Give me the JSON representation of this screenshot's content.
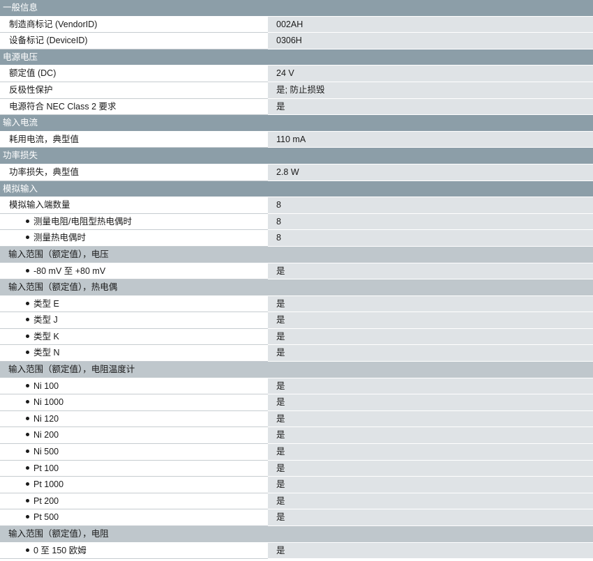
{
  "rows": [
    {
      "type": "section",
      "text": "一般信息"
    },
    {
      "type": "data",
      "level": 0,
      "label": "制造商标记 (VendorID)",
      "value": "002AH"
    },
    {
      "type": "data",
      "level": 0,
      "label": "设备标记 (DeviceID)",
      "value": "0306H"
    },
    {
      "type": "section",
      "text": "电源电压"
    },
    {
      "type": "data",
      "level": 0,
      "label": "额定值 (DC)",
      "value": "24 V"
    },
    {
      "type": "data",
      "level": 0,
      "label": "反极性保护",
      "value": "是; 防止损毁"
    },
    {
      "type": "data",
      "level": 0,
      "label": "电源符合 NEC Class 2 要求",
      "value": "是"
    },
    {
      "type": "section",
      "text": "输入电流"
    },
    {
      "type": "data",
      "level": 0,
      "label": "耗用电流，典型值",
      "value": "110 mA"
    },
    {
      "type": "section",
      "text": "功率损失"
    },
    {
      "type": "data",
      "level": 0,
      "label": "功率损失，典型值",
      "value": "2.8 W"
    },
    {
      "type": "section",
      "text": "模拟输入"
    },
    {
      "type": "data",
      "level": 0,
      "label": "模拟输入端数量",
      "value": "8"
    },
    {
      "type": "data",
      "level": 1,
      "label": "测量电阻/电阻型热电偶时",
      "value": "8"
    },
    {
      "type": "data",
      "level": 1,
      "label": "测量热电偶时",
      "value": "8"
    },
    {
      "type": "subsection",
      "text": "输入范围（额定值），电压"
    },
    {
      "type": "data",
      "level": 1,
      "label": "-80 mV 至 +80 mV",
      "value": "是"
    },
    {
      "type": "subsection",
      "text": "输入范围（额定值），热电偶"
    },
    {
      "type": "data",
      "level": 1,
      "label": "类型 E",
      "value": "是"
    },
    {
      "type": "data",
      "level": 1,
      "label": "类型 J",
      "value": "是"
    },
    {
      "type": "data",
      "level": 1,
      "label": "类型 K",
      "value": "是"
    },
    {
      "type": "data",
      "level": 1,
      "label": "类型 N",
      "value": "是"
    },
    {
      "type": "subsection",
      "text": "输入范围（额定值），电阻温度计"
    },
    {
      "type": "data",
      "level": 1,
      "label": "Ni 100",
      "value": "是"
    },
    {
      "type": "data",
      "level": 1,
      "label": "Ni 1000",
      "value": "是"
    },
    {
      "type": "data",
      "level": 1,
      "label": "Ni 120",
      "value": "是"
    },
    {
      "type": "data",
      "level": 1,
      "label": "Ni 200",
      "value": "是"
    },
    {
      "type": "data",
      "level": 1,
      "label": "Ni 500",
      "value": "是"
    },
    {
      "type": "data",
      "level": 1,
      "label": "Pt 100",
      "value": "是"
    },
    {
      "type": "data",
      "level": 1,
      "label": "Pt 1000",
      "value": "是"
    },
    {
      "type": "data",
      "level": 1,
      "label": "Pt 200",
      "value": "是"
    },
    {
      "type": "data",
      "level": 1,
      "label": "Pt 500",
      "value": "是"
    },
    {
      "type": "subsection",
      "text": "输入范围（额定值），电阻"
    },
    {
      "type": "data",
      "level": 1,
      "label": "0 至 150 欧姆",
      "value": "是"
    }
  ]
}
